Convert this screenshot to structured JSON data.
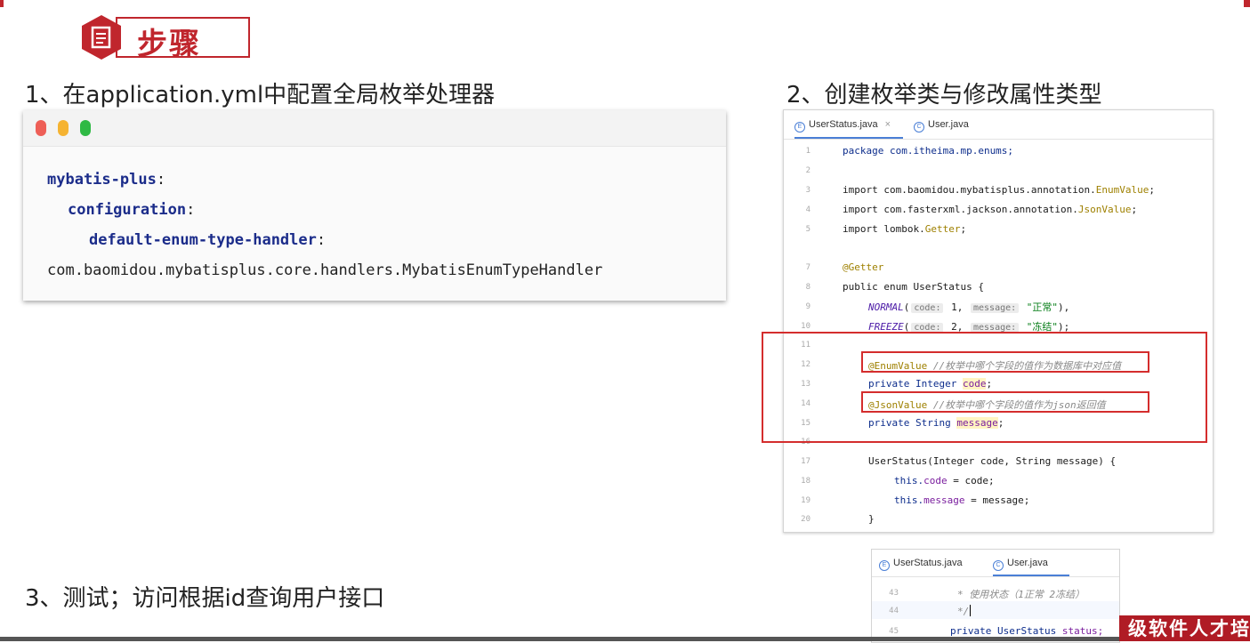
{
  "header": {
    "title": "步骤",
    "icon": "document-icon"
  },
  "steps": {
    "step1": "1、在application.yml中配置全局枚举处理器",
    "step2": "2、创建枚举类与修改属性类型",
    "step3": "3、测试；访问根据id查询用户接口"
  },
  "yml": {
    "l1": "mybatis-plus",
    "l2": "configuration",
    "l3": "default-enum-type-handler",
    "colon": ":",
    "l4": "com.baomidou.mybatisplus.core.handlers.MybatisEnumTypeHandler"
  },
  "editor1": {
    "tabs": [
      {
        "label": "UserStatus.java",
        "icon": "enum-icon",
        "glyph": "E",
        "close": "×"
      },
      {
        "label": "User.java",
        "icon": "class-icon",
        "glyph": "C"
      }
    ],
    "line_numbers": [
      "1",
      "2",
      "3",
      "4",
      "5",
      "7",
      "8",
      "9",
      "10",
      "11",
      "12",
      "13",
      "14",
      "15",
      "16",
      "17",
      "18",
      "19",
      "20"
    ],
    "code": {
      "package": "package com.itheima.mp.enums;",
      "imp1_a": "import com.baomidou.mybatisplus.annotation.",
      "imp1_b": "EnumValue",
      "imp2_a": "import com.fasterxml.jackson.annotation.",
      "imp2_b": "JsonValue",
      "imp3_a": "import lombok.",
      "imp3_b": "Getter",
      "getter": "@Getter",
      "class_decl": "public enum UserStatus {",
      "normal_name": "NORMAL",
      "normal_code": "1",
      "normal_msg": "\"正常\"",
      "freeze_name": "FREEZE",
      "freeze_code": "2",
      "freeze_msg": "\"冻结\"",
      "hint_code": "code:",
      "hint_message": "message:",
      "enumvalue_ann": "@EnumValue",
      "enumvalue_cmt": "//枚举中哪个字段的值作为数据库中对应值",
      "code_field_a": "private Integer ",
      "code_field_b": "code",
      "jsonvalue_ann": "@JsonValue",
      "jsonvalue_cmt": "//枚举中哪个字段的值作为json返回值",
      "msg_field_a": "private String ",
      "msg_field_b": "message",
      "ctor": "UserStatus(Integer code, String message) {",
      "this_code_a": "this.",
      "this_code_b": "code",
      "this_code_c": " = code;",
      "this_msg_a": "this.",
      "this_msg_b": "message",
      "this_msg_c": " = message;",
      "close_brace": "}"
    }
  },
  "editor2": {
    "tabs": [
      {
        "label": "UserStatus.java",
        "icon": "enum-icon",
        "glyph": "E"
      },
      {
        "label": "User.java",
        "icon": "class-icon",
        "glyph": "C"
      }
    ],
    "line_numbers": [
      "43",
      "44",
      "45"
    ],
    "code": {
      "comment": "* 使用状态（1正常 2冻结）",
      "comment_end": "*/",
      "field_a": "private UserStatus ",
      "field_b": "status;"
    }
  },
  "ribbon": "级软件人才培"
}
